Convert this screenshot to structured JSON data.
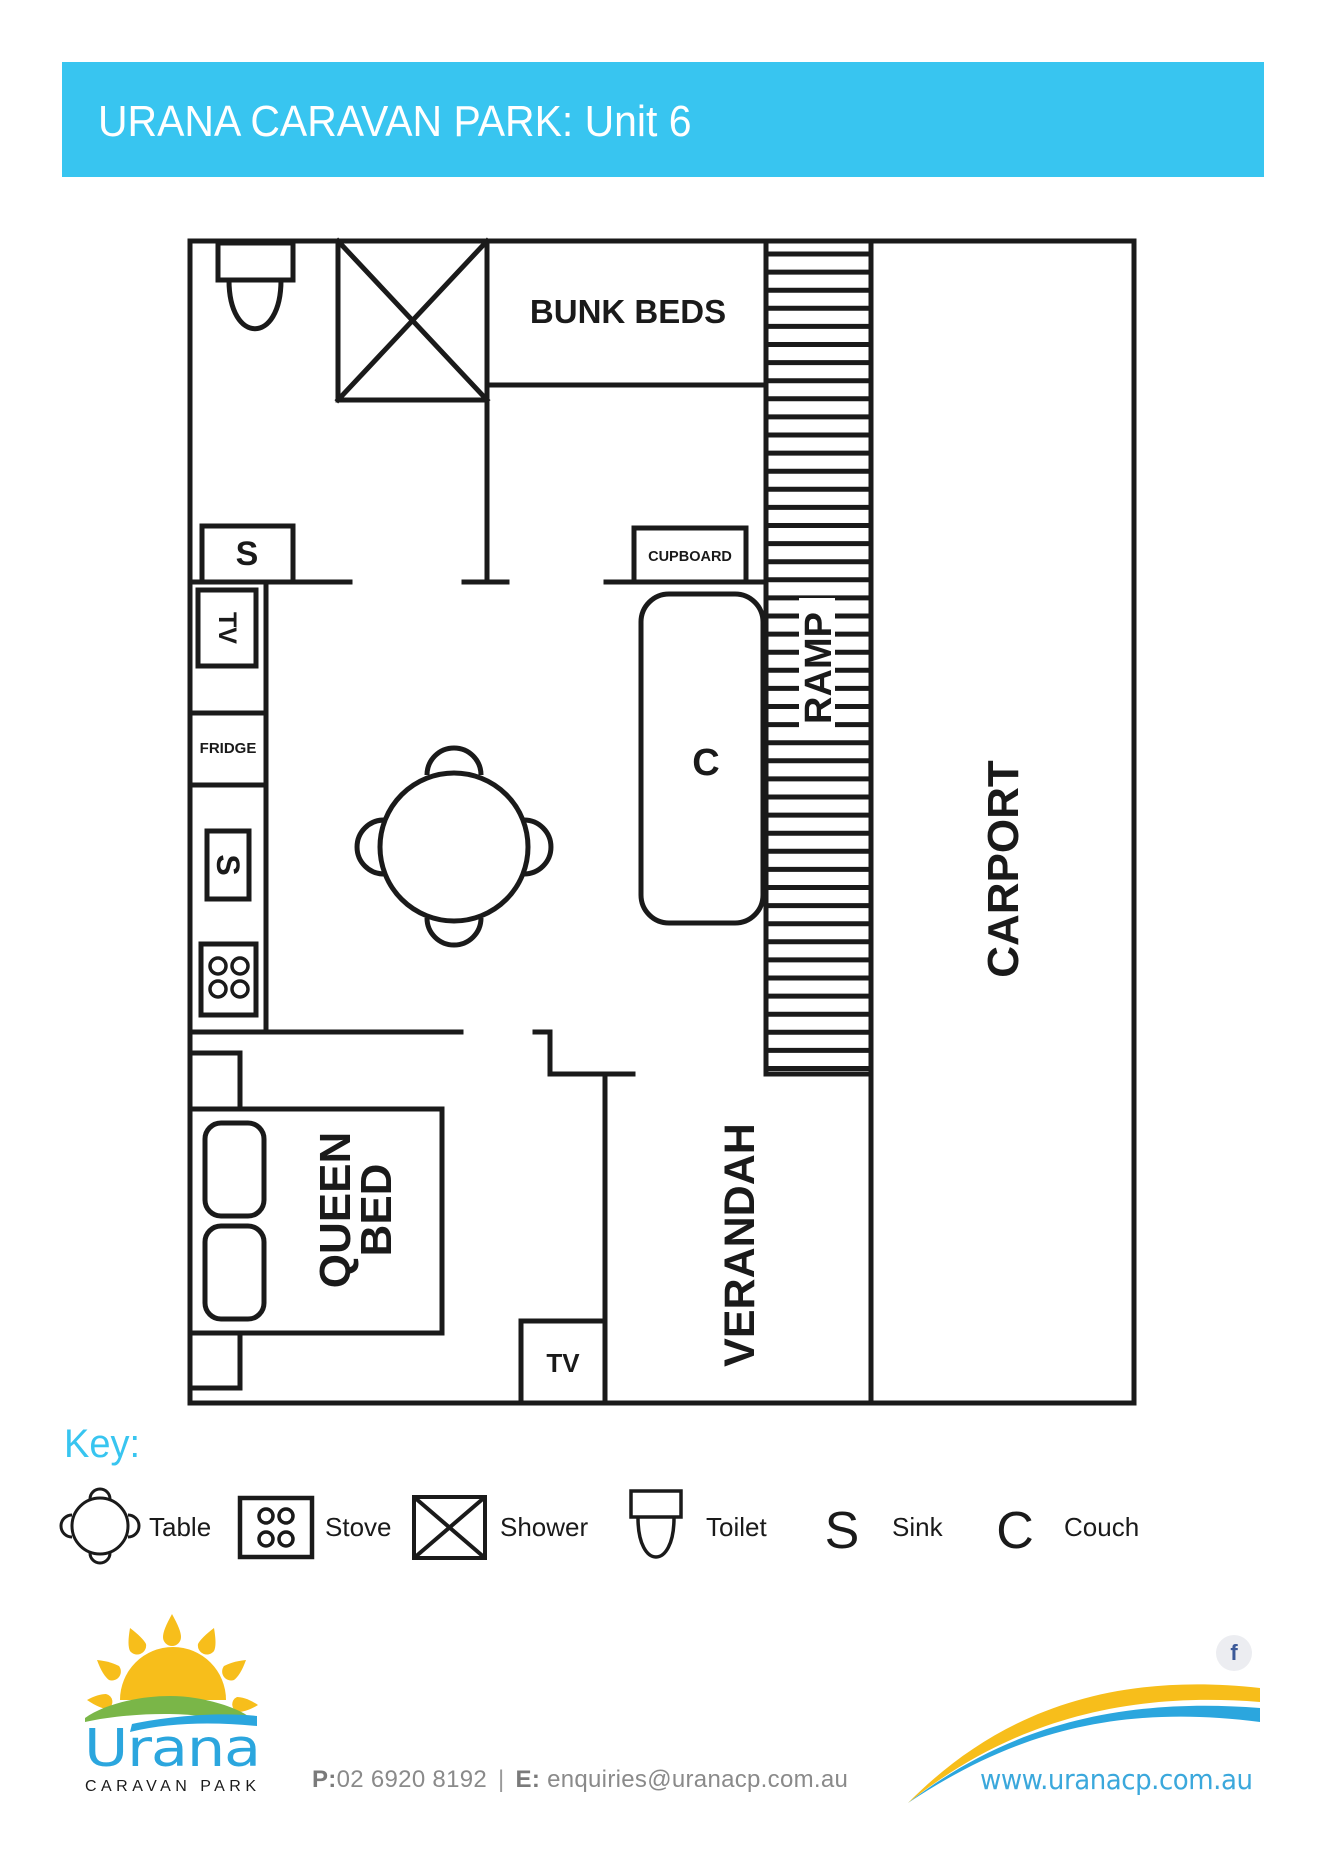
{
  "header": {
    "title": "URANA CARAVAN PARK: Unit 6",
    "background_color": "#38C5F0"
  },
  "floor_plan": {
    "rooms": {
      "bunk_beds": "BUNK BEDS",
      "queen_bed_line1": "QUEEN",
      "queen_bed_line2": "BED",
      "verandah": "VERANDAH",
      "carport": "CARPORT",
      "ramp": "RAMP"
    },
    "fixtures": {
      "cupboard": "CUPBOARD",
      "fridge": "FRIDGE",
      "tv_kitchen": "TV",
      "tv_bedroom": "TV",
      "sink_bathroom": "S",
      "sink_kitchen": "S",
      "couch": "C"
    }
  },
  "key": {
    "title": "Key:",
    "color": "#38C5F0",
    "items": [
      {
        "icon": "table-icon",
        "label": "Table"
      },
      {
        "icon": "stove-icon",
        "label": "Stove"
      },
      {
        "icon": "shower-icon",
        "label": "Shower"
      },
      {
        "icon": "toilet-icon",
        "label": "Toilet"
      },
      {
        "icon": "S",
        "label": "Sink"
      },
      {
        "icon": "C",
        "label": "Couch"
      }
    ]
  },
  "footer": {
    "logo": {
      "name": "Urana",
      "subtitle": "CARAVAN PARK",
      "sun_color": "#F7BE1B",
      "hill_color": "#7AB648",
      "water_color": "#2BA6DE"
    },
    "phone_label": "P:",
    "phone": "02 6920 8192",
    "separator": "|",
    "email_label": "E:",
    "email": "enquiries@uranacp.com.au",
    "website": "www.uranacp.com.au",
    "social": {
      "icon": "facebook-icon",
      "glyph": "f"
    }
  }
}
